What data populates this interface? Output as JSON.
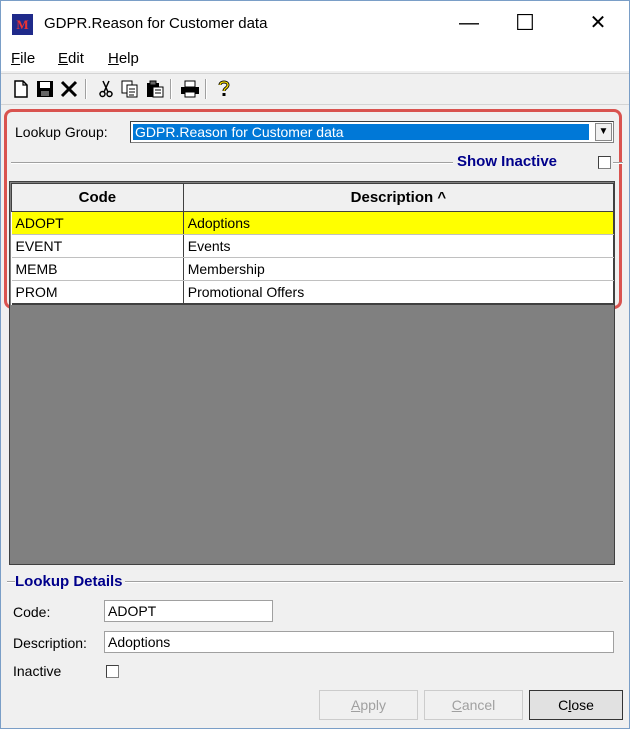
{
  "window": {
    "icon_letter": "M",
    "title": "GDPR.Reason for Customer data",
    "minimize_glyph": "—",
    "maximize_glyph": "☐",
    "close_glyph": "✕"
  },
  "menu": {
    "items": [
      {
        "accel": "F",
        "rest": "ile"
      },
      {
        "accel": "E",
        "rest": "dit"
      },
      {
        "accel": "H",
        "rest": "elp"
      }
    ]
  },
  "toolbar": {
    "icons": [
      "new-icon",
      "save-icon",
      "delete-icon",
      "cut-icon",
      "copy-icon",
      "paste-icon",
      "print-icon",
      "help-icon"
    ]
  },
  "lookup": {
    "label": "Lookup Group:",
    "selected": "GDPR.Reason for Customer data",
    "show_inactive_label": "Show Inactive"
  },
  "grid": {
    "columns": [
      "Code",
      "Description ^"
    ],
    "rows": [
      {
        "code": "ADOPT",
        "description": "Adoptions"
      },
      {
        "code": "EVENT",
        "description": "Events"
      },
      {
        "code": "MEMB",
        "description": "Membership"
      },
      {
        "code": "PROM",
        "description": "Promotional Offers"
      }
    ],
    "selected_index": 0
  },
  "details": {
    "title": "Lookup Details",
    "code_label": "Code:",
    "code_value": "ADOPT",
    "description_label": "Description:",
    "description_value": "Adoptions",
    "inactive_label": "Inactive"
  },
  "buttons": {
    "apply": {
      "accel": "A",
      "rest": "pply"
    },
    "cancel": {
      "accel": "C",
      "rest": "ancel"
    },
    "close": {
      "pre": "C",
      "accel": "l",
      "rest": "ose"
    }
  },
  "colors": {
    "selected_row": "#ffff00",
    "group_title": "#00008b",
    "highlight_frame": "#d9534f",
    "combo_selection": "#0078d7"
  }
}
